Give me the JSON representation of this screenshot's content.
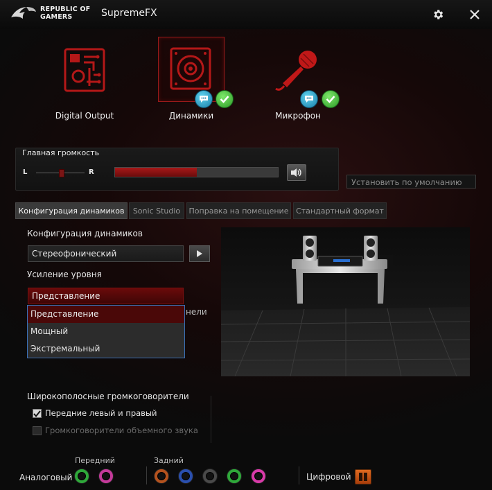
{
  "header": {
    "brand_line1": "REPUBLIC OF",
    "brand_line2": "GAMERS",
    "title": "SupremeFX",
    "settings_icon": "gear-icon",
    "close_icon": "close-icon"
  },
  "devices": [
    {
      "label": "Digital Output",
      "icon": "digital-output-icon",
      "selected": false
    },
    {
      "label": "Динамики",
      "icon": "speaker-icon",
      "selected": true,
      "badges": [
        "chat-icon",
        "check-icon"
      ]
    },
    {
      "label": "Микрофон",
      "icon": "microphone-icon",
      "selected": false,
      "badges": [
        "chat-icon",
        "check-icon"
      ]
    }
  ],
  "master_volume": {
    "title": "Главная громкость",
    "left_label": "L",
    "right_label": "R",
    "balance_fraction": 0.5,
    "level_fraction": 0.5,
    "mute_icon": "speaker-volume-icon"
  },
  "set_default": {
    "label": "Установить по умолчанию"
  },
  "tabs": [
    {
      "label": "Конфигурация динамиков",
      "active": true
    },
    {
      "label": "Sonic Studio",
      "active": false
    },
    {
      "label": "Поправка на помещение",
      "active": false
    },
    {
      "label": "Стандартный формат",
      "active": false
    }
  ],
  "speaker_config": {
    "label": "Конфигурация динамиков",
    "value": "Стереофонический",
    "play_icon": "play-icon"
  },
  "gain": {
    "label": "Усиление уровня",
    "value": "Представление",
    "options": [
      "Представление",
      "Мощный",
      "Экстремальный"
    ],
    "selected_index": 0
  },
  "hidden_label_fragment": "нели",
  "wideband": {
    "title": "Широкополосные громкоговорители",
    "items": [
      {
        "label": "Передние левый и правый",
        "checked": true,
        "enabled": true
      },
      {
        "label": "Громкоговорители объемного звука",
        "checked": false,
        "enabled": false
      }
    ]
  },
  "jacks": {
    "analog_label": "Аналоговый",
    "front_label": "Передний",
    "rear_label": "Задний",
    "digital_label": "Цифровой",
    "front_colors": [
      "#2fa83a",
      "#c43a9a"
    ],
    "rear_colors": [
      "#b4521e",
      "#2a4fae",
      "#4a4a4a",
      "#2fa83a",
      "#d83aa8"
    ]
  }
}
